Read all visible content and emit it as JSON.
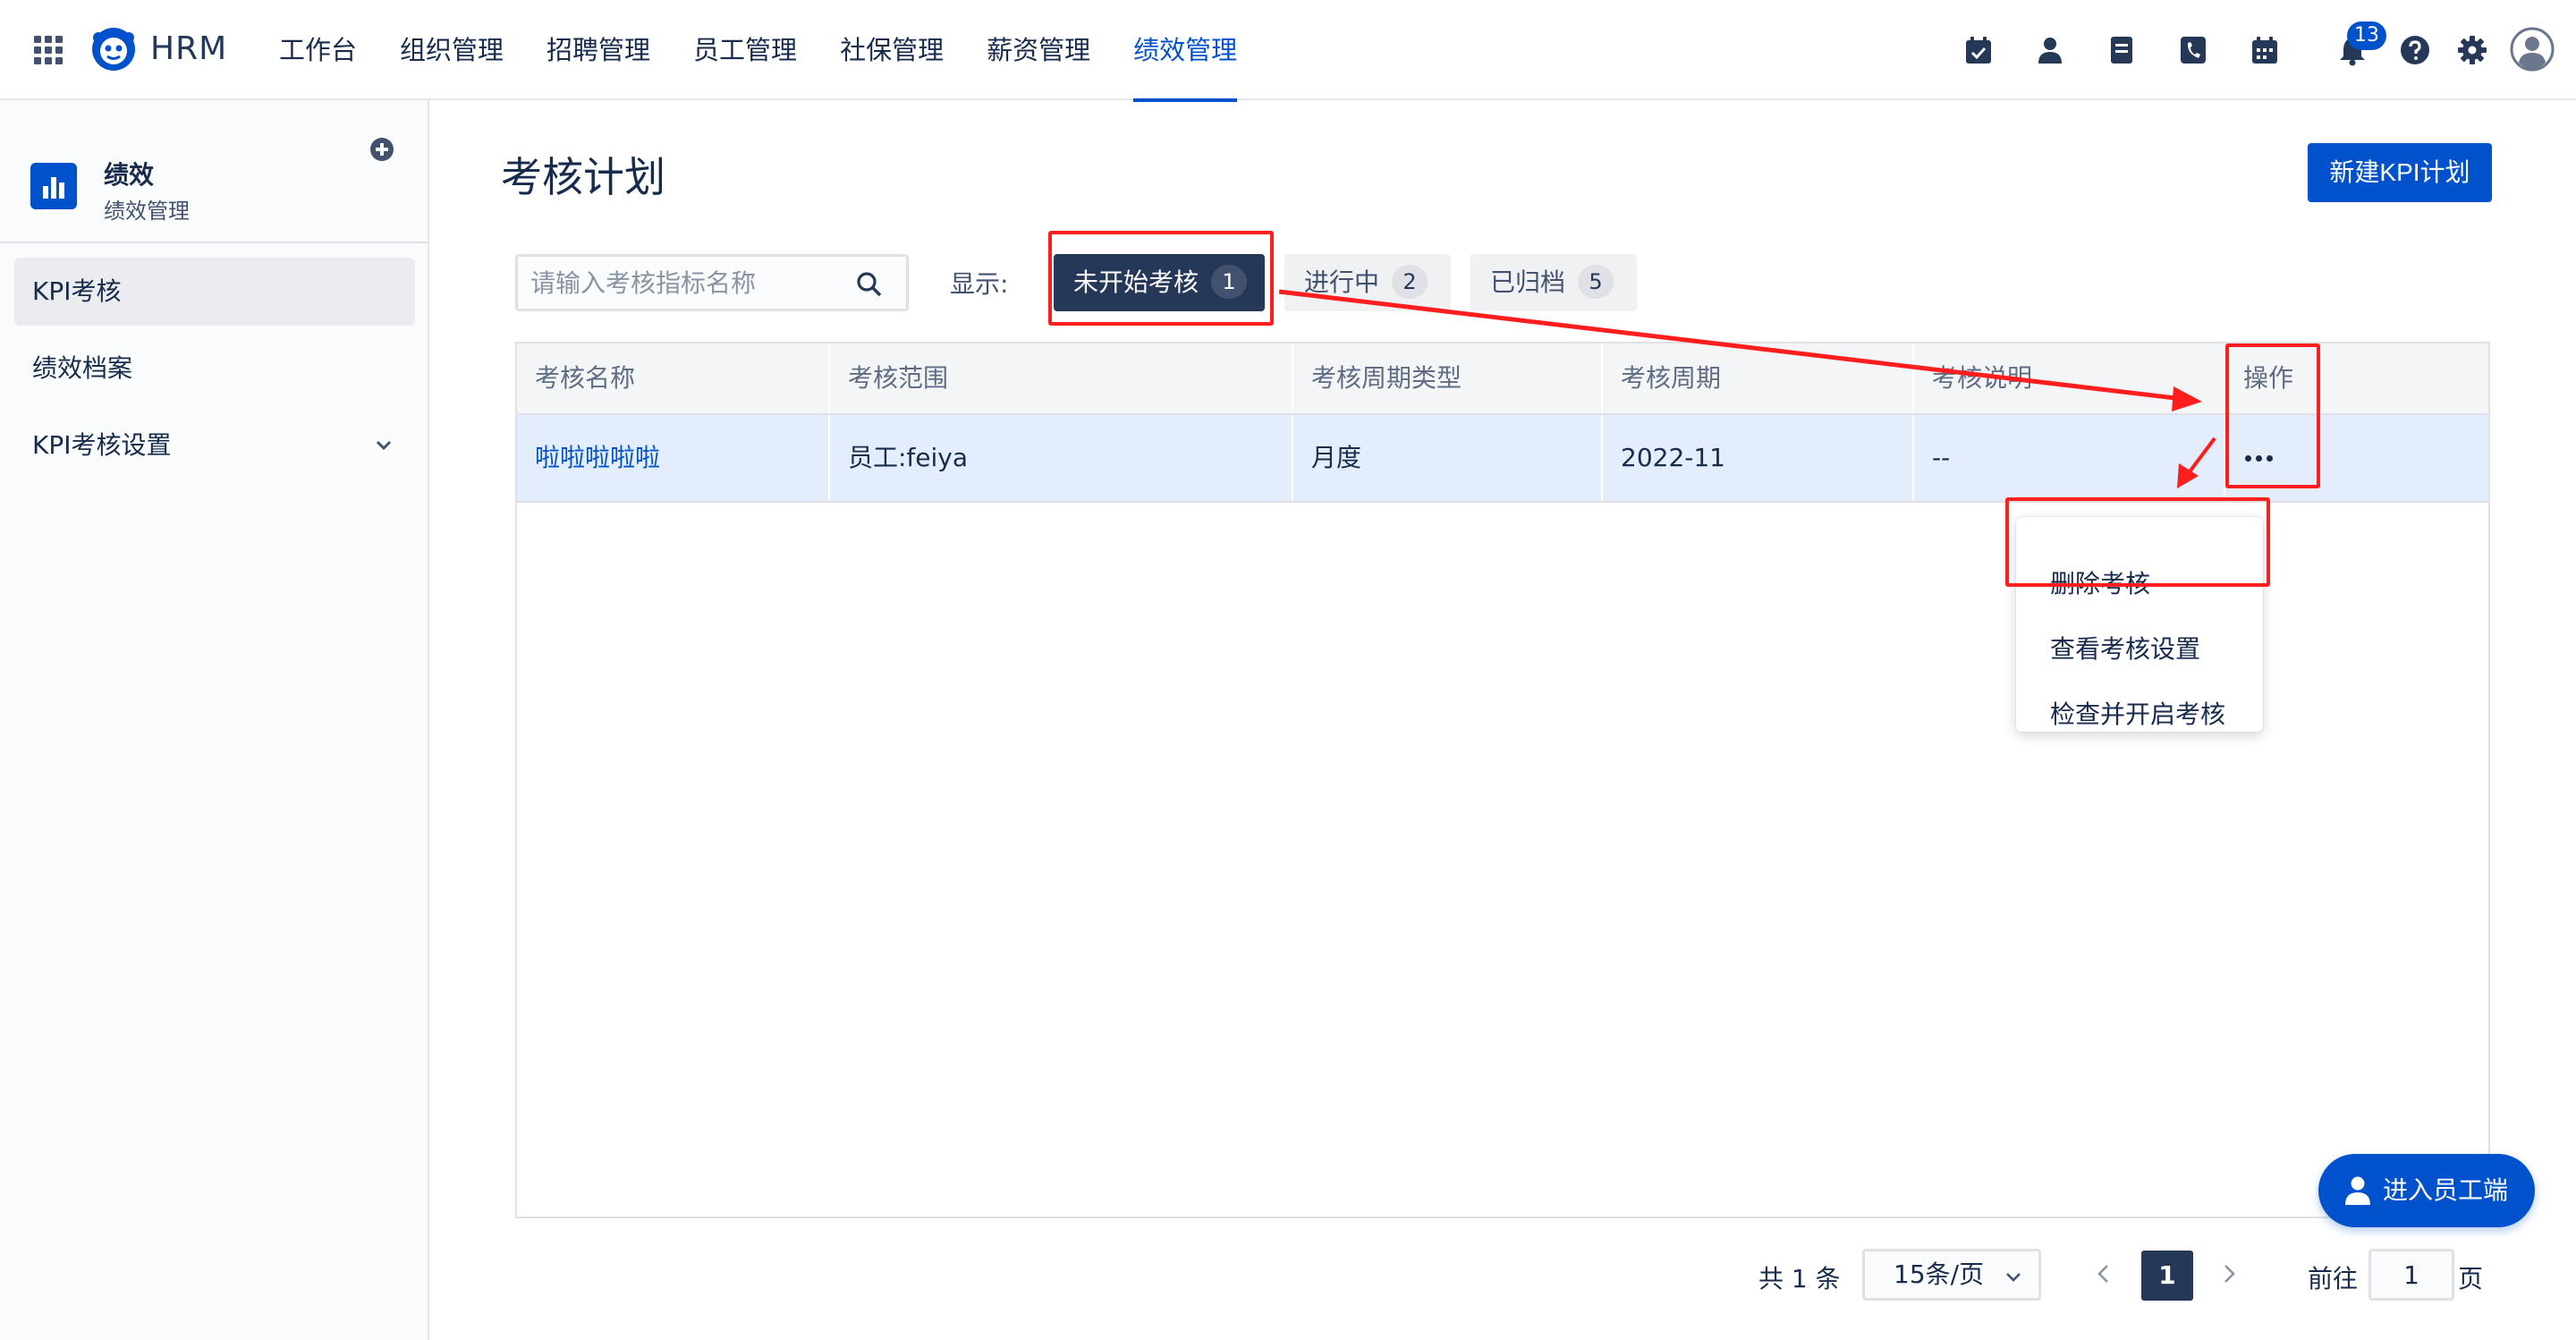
{
  "app": {
    "brand": "HRM"
  },
  "nav": [
    {
      "label": "工作台"
    },
    {
      "label": "组织管理"
    },
    {
      "label": "招聘管理"
    },
    {
      "label": "员工管理"
    },
    {
      "label": "社保管理"
    },
    {
      "label": "薪资管理"
    },
    {
      "label": "绩效管理",
      "active": true
    }
  ],
  "header_icons": [
    "calendar-check-icon",
    "person-icon",
    "document-icon",
    "phone-icon",
    "calendar-icon",
    "bell-icon",
    "help-icon",
    "gear-icon",
    "avatar-icon"
  ],
  "notifications": {
    "count": "13"
  },
  "sidebar": {
    "title": "绩效",
    "subtitle": "绩效管理",
    "items": [
      {
        "label": "KPI考核",
        "active": true
      },
      {
        "label": "绩效档案"
      },
      {
        "label": "KPI考核设置",
        "expandable": true
      }
    ]
  },
  "main": {
    "title": "考核计划",
    "new_button": "新建KPI计划",
    "search": {
      "placeholder": "请输入考核指标名称",
      "value": ""
    },
    "filter_label": "显示:",
    "filters": [
      {
        "label": "未开始考核",
        "count": "1",
        "active": true
      },
      {
        "label": "进行中",
        "count": "2"
      },
      {
        "label": "已归档",
        "count": "5"
      }
    ]
  },
  "table": {
    "columns": [
      "考核名称",
      "考核范围",
      "考核周期类型",
      "考核周期",
      "考核说明",
      "操作"
    ],
    "rows": [
      {
        "name": "啦啦啦啦啦",
        "scope": "员工:feiya",
        "period_type": "月度",
        "period": "2022-11",
        "description": "--",
        "action": "•••"
      }
    ]
  },
  "row_menu": {
    "items": [
      "删除考核",
      "查看考核设置",
      "检查并开启考核"
    ]
  },
  "pagination": {
    "total": "共 1 条",
    "page_size": "15条/页",
    "current": "1",
    "goto_label": "前往",
    "goto_value": "1",
    "page_suffix": "页"
  },
  "float_button": {
    "label": "进入员工端"
  },
  "colors": {
    "primary": "#0052cc",
    "dark": "#253858",
    "annotation": "#ff1e1e",
    "row_highlight": "#e3edfc"
  }
}
